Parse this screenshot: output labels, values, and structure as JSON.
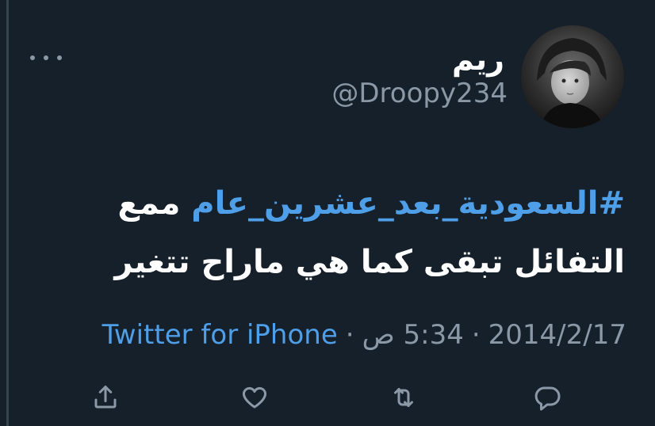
{
  "tweet": {
    "display_name": "ريم",
    "handle": "@Droopy234",
    "hashtag": "#السعودية_بعد_عشرين_عام",
    "text_line1_rest": "ممع",
    "text_line2": "التفائل تبقى كما هي ماراح تتغير",
    "date": "2014/2/17",
    "time": "5:34 ص",
    "separator": "·",
    "source": "Twitter for iPhone"
  },
  "icons": {
    "more": "more-horizontal-icon",
    "reply": "reply-icon",
    "retweet": "retweet-icon",
    "like": "like-icon",
    "share": "share-icon"
  },
  "colors": {
    "background": "#15202b",
    "link": "#4f9ee8",
    "muted": "#8b98a5",
    "text": "#ffffff"
  }
}
